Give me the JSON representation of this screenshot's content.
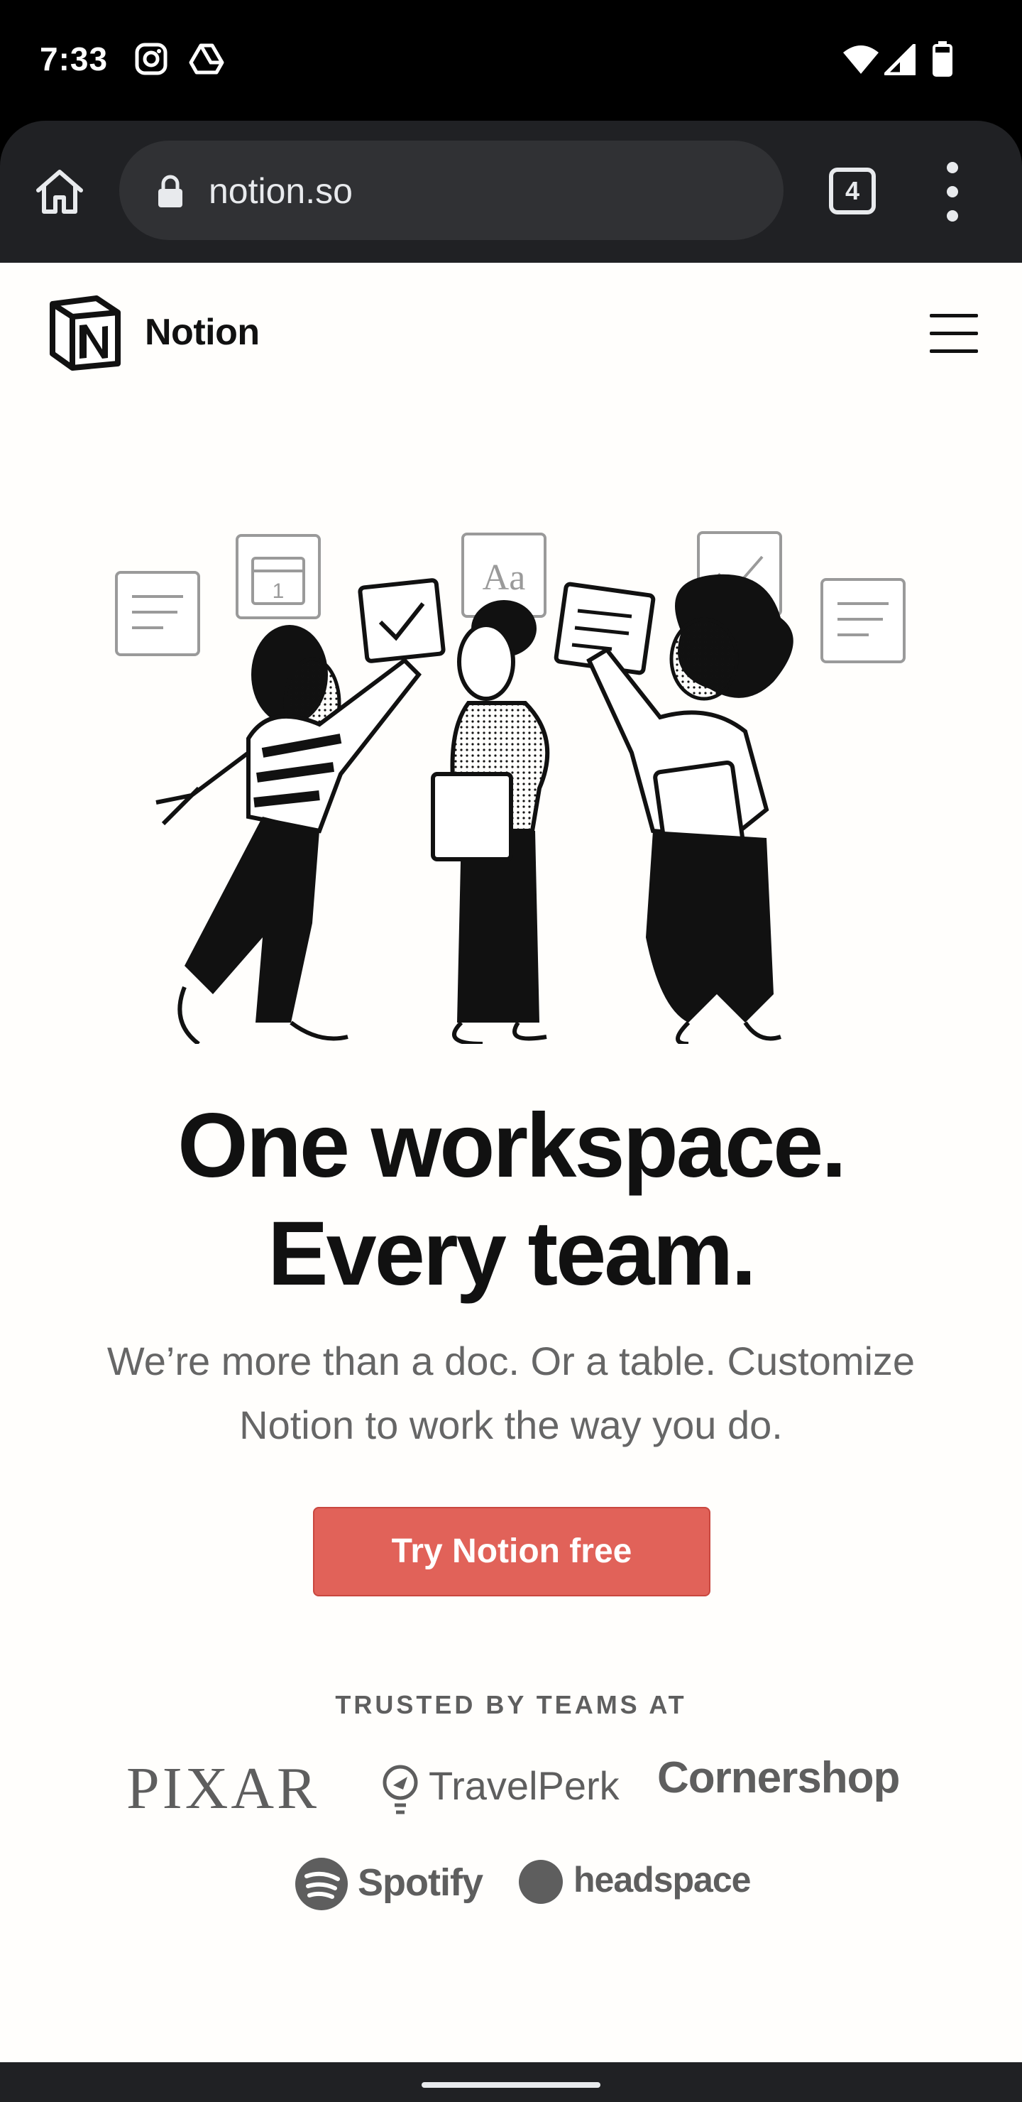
{
  "status_bar": {
    "time": "7:33",
    "left_icons": [
      "instagram-icon",
      "drive-icon"
    ],
    "right_icons": [
      "wifi-icon",
      "signal-icon",
      "battery-icon"
    ]
  },
  "browser": {
    "url": "notion.so",
    "tab_count": "4",
    "icons": [
      "home-icon",
      "lock-icon",
      "tabs-icon",
      "more-icon"
    ]
  },
  "site": {
    "brand": "Notion",
    "headline_line1": "One workspace.",
    "headline_line2": "Every team.",
    "subhead": "We’re more than a doc. Or a table. Customize Notion to work the way you do.",
    "cta_label": "Try Notion free",
    "trusted_label": "TRUSTED BY TEAMS AT",
    "logos": [
      "PIXAR",
      "TravelPerk",
      "Cornershop",
      "Spotify",
      "headspace"
    ],
    "colors": {
      "cta": "#e16259",
      "background": "#fffefc",
      "text": "#111111"
    }
  }
}
